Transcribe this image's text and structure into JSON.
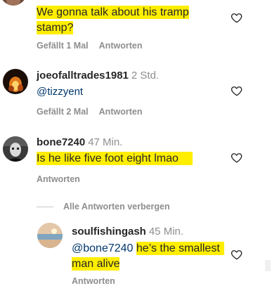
{
  "comments": [
    {
      "text": "We gonna talk about his tramp stamp?",
      "likes": "Gefällt 1 Mal",
      "reply": "Antworten"
    },
    {
      "username": "joeofalltrades1981",
      "time": "2 Std.",
      "mention": "@tizzyent",
      "likes": "Gefällt 2 Mal",
      "reply": "Antworten"
    },
    {
      "username": "bone7240",
      "time": "47 Min.",
      "text": "Is he like five foot eight lmao",
      "reply": "Antworten"
    }
  ],
  "hide_replies": "Alle Antworten verbergen",
  "reply_comment": {
    "username": "soulfishingash",
    "time": "45 Min.",
    "mention": "@bone7240",
    "text_line1": "he’s the smallest",
    "text_line2": "man alive",
    "reply": "Antworten"
  },
  "icons": {
    "like": "heart-outline-icon"
  },
  "colors": {
    "highlight": "#ffee00",
    "mention": "#00376b",
    "secondary": "#8e8e8e"
  }
}
